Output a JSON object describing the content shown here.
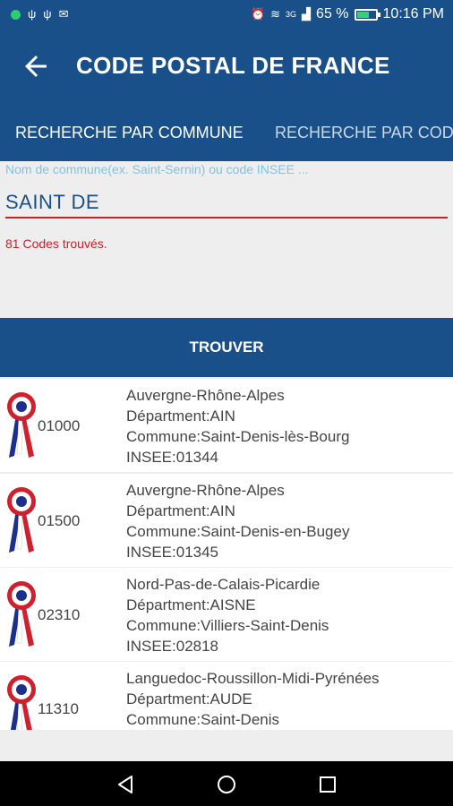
{
  "status_bar": {
    "battery": "65 %",
    "time": "10:16 PM",
    "network": "3G"
  },
  "app_bar": {
    "title": "CODE POSTAL DE FRANCE"
  },
  "tabs": [
    {
      "label": "RECHERCHE PAR COMMUNE"
    },
    {
      "label": "RECHERCHE PAR CODE"
    }
  ],
  "search": {
    "placeholder": "Nom de commune(ex. Saint-Sernin) ou code INSEE ...",
    "value": "SAINT DE",
    "result_count": "81 Codes trouvés."
  },
  "button": {
    "label": "TROUVER"
  },
  "results": [
    {
      "code": "01000",
      "region": "Auvergne-Rhône-Alpes",
      "department": "Départment:AIN",
      "commune": "Commune:Saint-Denis-lès-Bourg",
      "insee": "INSEE:01344"
    },
    {
      "code": "01500",
      "region": "Auvergne-Rhône-Alpes",
      "department": "Départment:AIN",
      "commune": "Commune:Saint-Denis-en-Bugey",
      "insee": "INSEE:01345"
    },
    {
      "code": "02310",
      "region": "Nord-Pas-de-Calais-Picardie",
      "department": "Départment:AISNE",
      "commune": "Commune:Villiers-Saint-Denis",
      "insee": "INSEE:02818"
    },
    {
      "code": "11310",
      "region": "Languedoc-Roussillon-Midi-Pyrénées",
      "department": "Départment:AUDE",
      "commune": "Commune:Saint-Denis",
      "insee": ""
    }
  ],
  "colors": {
    "primary": "#1a5089",
    "accent": "#cc1f2b",
    "placeholder": "#7dc4e4"
  },
  "icons": {
    "back": "arrow-left-icon",
    "cocarde": "french-cocarde-icon"
  }
}
